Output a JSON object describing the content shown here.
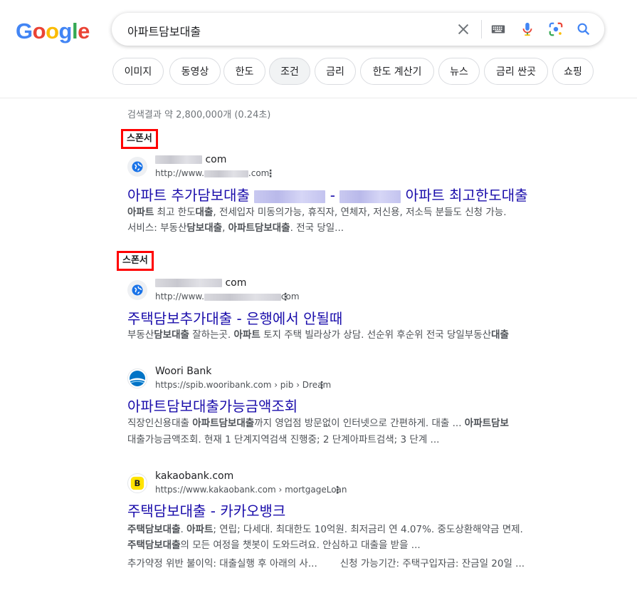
{
  "logo": {
    "letters": [
      "G",
      "o",
      "o",
      "g",
      "l",
      "e"
    ],
    "colors": [
      "#4285F4",
      "#EA4335",
      "#FBBC05",
      "#4285F4",
      "#34A853",
      "#EA4335"
    ]
  },
  "search": {
    "query": "아파트담보대출"
  },
  "chips": [
    "이미지",
    "동영상",
    "한도",
    "조건",
    "금리",
    "한도 계산기",
    "뉴스",
    "금리 싼곳",
    "쇼핑"
  ],
  "active_chip": "조건",
  "stats": "검색결과 약 2,800,000개 (0.24초)",
  "sponsor_label": "스폰서",
  "results": [
    {
      "site_suffix": "com",
      "url_prefix": "http://www.",
      "url_suffix": ".com",
      "title_a": "아파트 추가담보대출",
      "title_b": "-",
      "title_c": "아파트 최고한도대출",
      "snippet1": [
        "아파트",
        " 최고 한도",
        "대출",
        ", 전세입자 미동의가능, 휴직자, 연체자, 저신용, 저소득 분들도 신청 가능."
      ],
      "snippet2": [
        "서비스: 부동산",
        "담보대출",
        ", ",
        "아파트담보대출",
        ". 전국 당일..."
      ]
    },
    {
      "site_suffix": "com",
      "url_prefix": "http://www.",
      "url_suffix": "com",
      "title": "주택담보추가대출 - 은행에서 안될때",
      "snippet1": [
        "부동산",
        "담보대출",
        " 잘하는곳. ",
        "아파트",
        " 토지 주택 빌라상가 상담. 선순위 후순위 전국 당일부동산",
        "대출"
      ]
    },
    {
      "site": "Woori Bank",
      "url": "https://spib.wooribank.com › pib › Dream",
      "title": "아파트담보대출가능금액조회",
      "snippet1": [
        "직장인신용대출 ",
        "아파트담보대출",
        "까지 영업점 방문없이 인터넷으로 간편하게. 대출 ... ",
        "아파트담보"
      ],
      "snippet2": [
        "대출가능금액조회. 현재 1 단계지역검색 진행중; 2 단계아파트검색; 3 단계 ..."
      ]
    },
    {
      "site": "kakaobank.com",
      "url": "https://www.kakaobank.com › mortgageLoan",
      "title": "주택담보대출 - 카카오뱅크",
      "snippet1": [
        "주택담보대출",
        ". ",
        "아파트",
        "; 연립; 다세대. 최대한도 10억원. 최저금리 연 4.07%. 중도상환해약금 면제."
      ],
      "snippet2": [
        "주택담보대출",
        "의 모든 여정을 챗봇이 도와드려요. 안심하고 대출을 받을 ..."
      ],
      "snippet3": [
        "추가약정 위반 불이익: 대출실행 후 아래의 사...",
        "신청 가능기간: 주택구입자금: 잔금일 20일 ..."
      ]
    }
  ]
}
